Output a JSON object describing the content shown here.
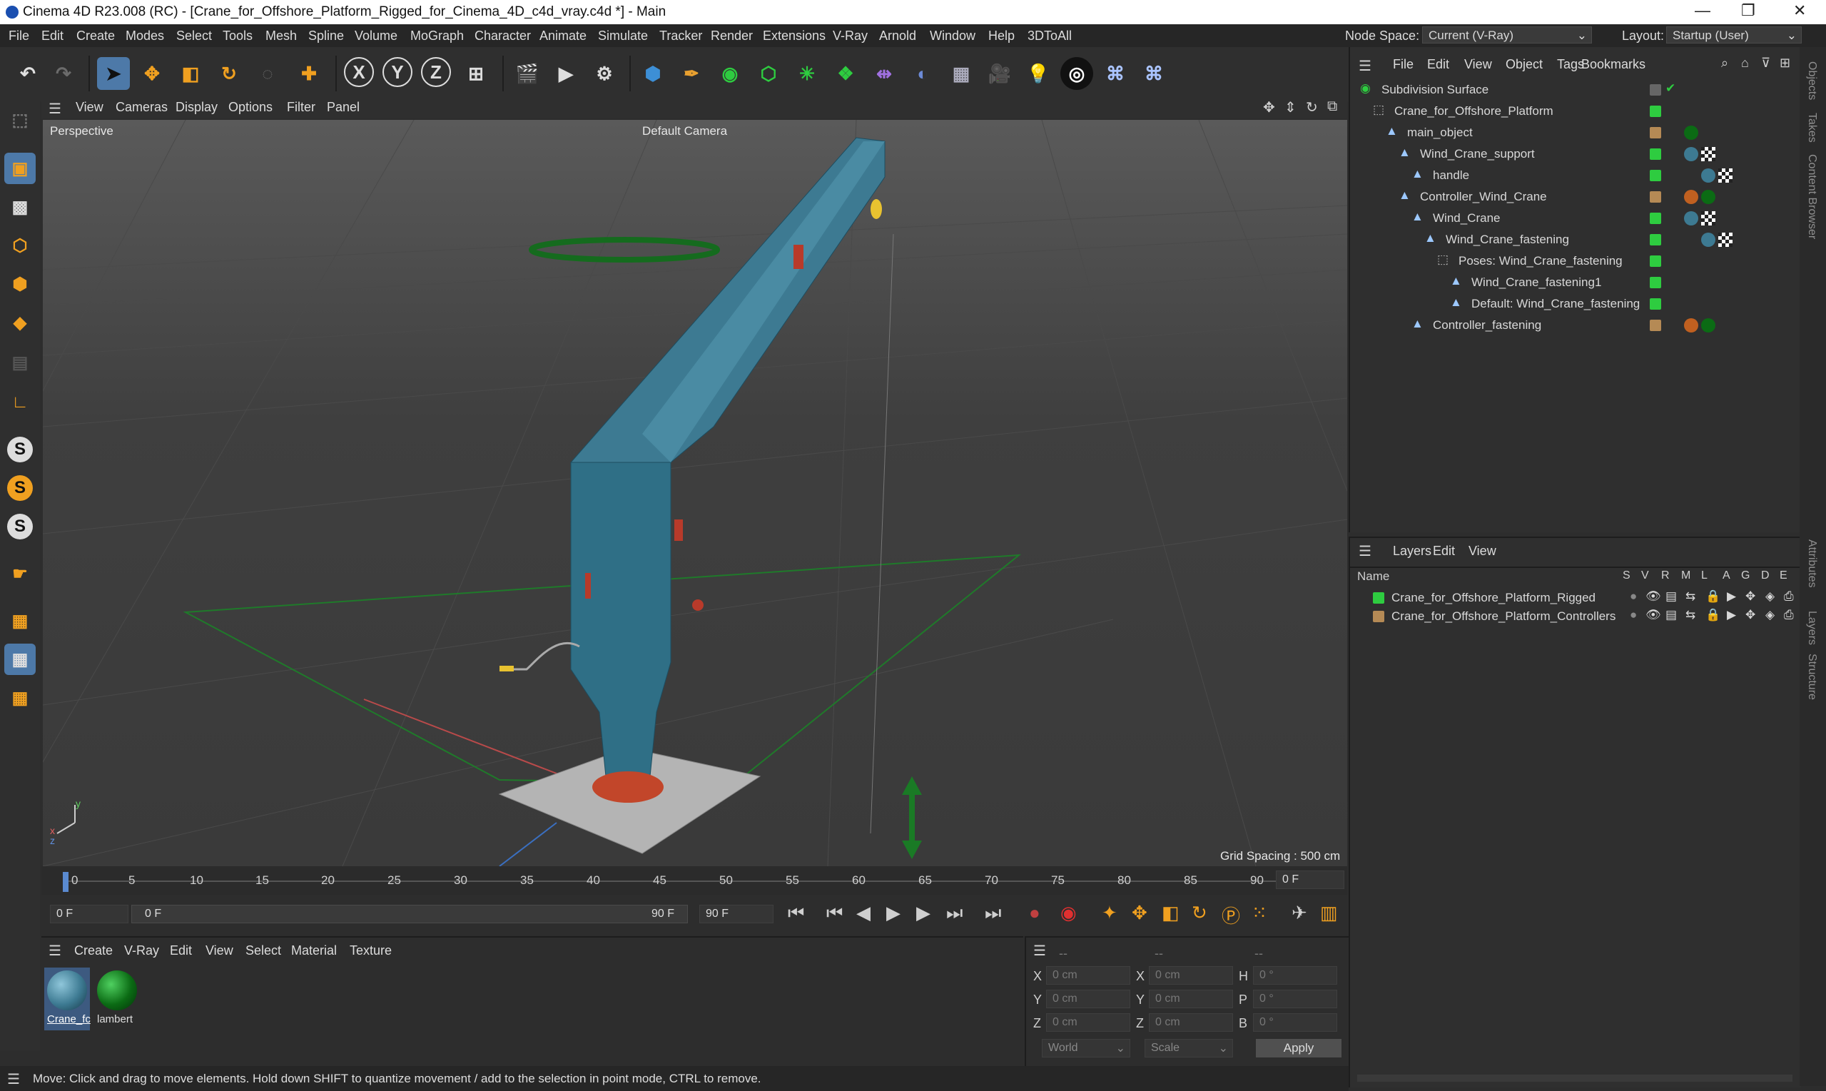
{
  "window": {
    "title": "Cinema 4D R23.008 (RC) - [Crane_for_Offshore_Platform_Rigged_for_Cinema_4D_c4d_vray.c4d *] - Main",
    "minimize": "—",
    "maximize": "❐",
    "close": "✕"
  },
  "menubar": {
    "items": [
      "File",
      "Edit",
      "Create",
      "Modes",
      "Select",
      "Tools",
      "Mesh",
      "Spline",
      "Volume",
      "MoGraph",
      "Character",
      "Animate",
      "Simulate",
      "Tracker",
      "Render",
      "Extensions",
      "V-Ray",
      "Arnold",
      "Window",
      "Help",
      "3DToAll"
    ],
    "node_space_label": "Node Space:",
    "node_space_value": "Current (V-Ray)",
    "layout_label": "Layout:",
    "layout_value": "Startup (User)"
  },
  "viewport": {
    "menu": [
      "View",
      "Cameras",
      "Display",
      "Options",
      "Filter",
      "Panel"
    ],
    "label_view": "Perspective",
    "label_camera": "Default Camera",
    "grid_spacing": "Grid Spacing : 500 cm",
    "axis_x": "x",
    "axis_y": "y",
    "axis_z": "z"
  },
  "timeline": {
    "ticks": [
      "0",
      "5",
      "10",
      "15",
      "20",
      "25",
      "30",
      "35",
      "40",
      "45",
      "50",
      "55",
      "60",
      "65",
      "70",
      "75",
      "80",
      "85",
      "90"
    ],
    "current_frame": "0 F",
    "start_field": "0 F",
    "range_start": "0 F",
    "range_end": "90 F",
    "end_field": "90 F"
  },
  "material_manager": {
    "menu": [
      "Create",
      "V-Ray",
      "Edit",
      "View",
      "Select",
      "Material",
      "Texture"
    ],
    "materials": [
      {
        "label": "Crane_fc",
        "color": "#3d7a92"
      },
      {
        "label": "lambert",
        "color": "#0b6b14"
      }
    ]
  },
  "coordinates": {
    "header_a": "--",
    "header_b": "--",
    "header_c": "--",
    "rows": [
      {
        "l1": "X",
        "v1": "0 cm",
        "l2": "X",
        "v2": "0 cm",
        "l3": "H",
        "v3": "0 °"
      },
      {
        "l1": "Y",
        "v1": "0 cm",
        "l2": "Y",
        "v2": "0 cm",
        "l3": "P",
        "v3": "0 °"
      },
      {
        "l1": "Z",
        "v1": "0 cm",
        "l2": "Z",
        "v2": "0 cm",
        "l3": "B",
        "v3": "0 °"
      }
    ],
    "space": "World",
    "mode": "Scale",
    "apply": "Apply"
  },
  "object_manager": {
    "menu": [
      "File",
      "Edit",
      "View",
      "Object",
      "Tags",
      "Bookmarks"
    ],
    "items": [
      {
        "name": "Subdivision Surface",
        "depth": 0,
        "color": "#888888"
      },
      {
        "name": "Crane_for_Offshore_Platform",
        "depth": 1,
        "color": "#2ecc40"
      },
      {
        "name": "main_object",
        "depth": 2,
        "color": "#b58a55"
      },
      {
        "name": "Wind_Crane_support",
        "depth": 3,
        "color": "#2ecc40"
      },
      {
        "name": "handle",
        "depth": 4,
        "color": "#2ecc40"
      },
      {
        "name": "Controller_Wind_Crane",
        "depth": 3,
        "color": "#b58a55"
      },
      {
        "name": "Wind_Crane",
        "depth": 4,
        "color": "#2ecc40"
      },
      {
        "name": "Wind_Crane_fastening",
        "depth": 5,
        "color": "#2ecc40"
      },
      {
        "name": "Poses: Wind_Crane_fastening",
        "depth": 6,
        "color": "#2ecc40"
      },
      {
        "name": "Wind_Crane_fastening1",
        "depth": 7,
        "color": "#2ecc40"
      },
      {
        "name": "Default: Wind_Crane_fastening",
        "depth": 7,
        "color": "#2ecc40"
      },
      {
        "name": "Controller_fastening",
        "depth": 4,
        "color": "#b58a55"
      }
    ]
  },
  "layer_manager": {
    "menu": [
      "Layers",
      "Edit",
      "View"
    ],
    "col_name": "Name",
    "col_flags": [
      "S",
      "V",
      "R",
      "M",
      "L",
      "A",
      "G",
      "D",
      "E"
    ],
    "layers": [
      {
        "name": "Crane_for_Offshore_Platform_Rigged",
        "color": "#2ecc40"
      },
      {
        "name": "Crane_for_Offshore_Platform_Controllers",
        "color": "#b58a55"
      }
    ]
  },
  "right_tabs": [
    "Objects",
    "Takes",
    "Content Browser",
    "Attributes",
    "Layers",
    "Structure"
  ],
  "status": "Move: Click and drag to move elements. Hold down SHIFT to quantize movement / add to the selection in point mode, CTRL to remove."
}
